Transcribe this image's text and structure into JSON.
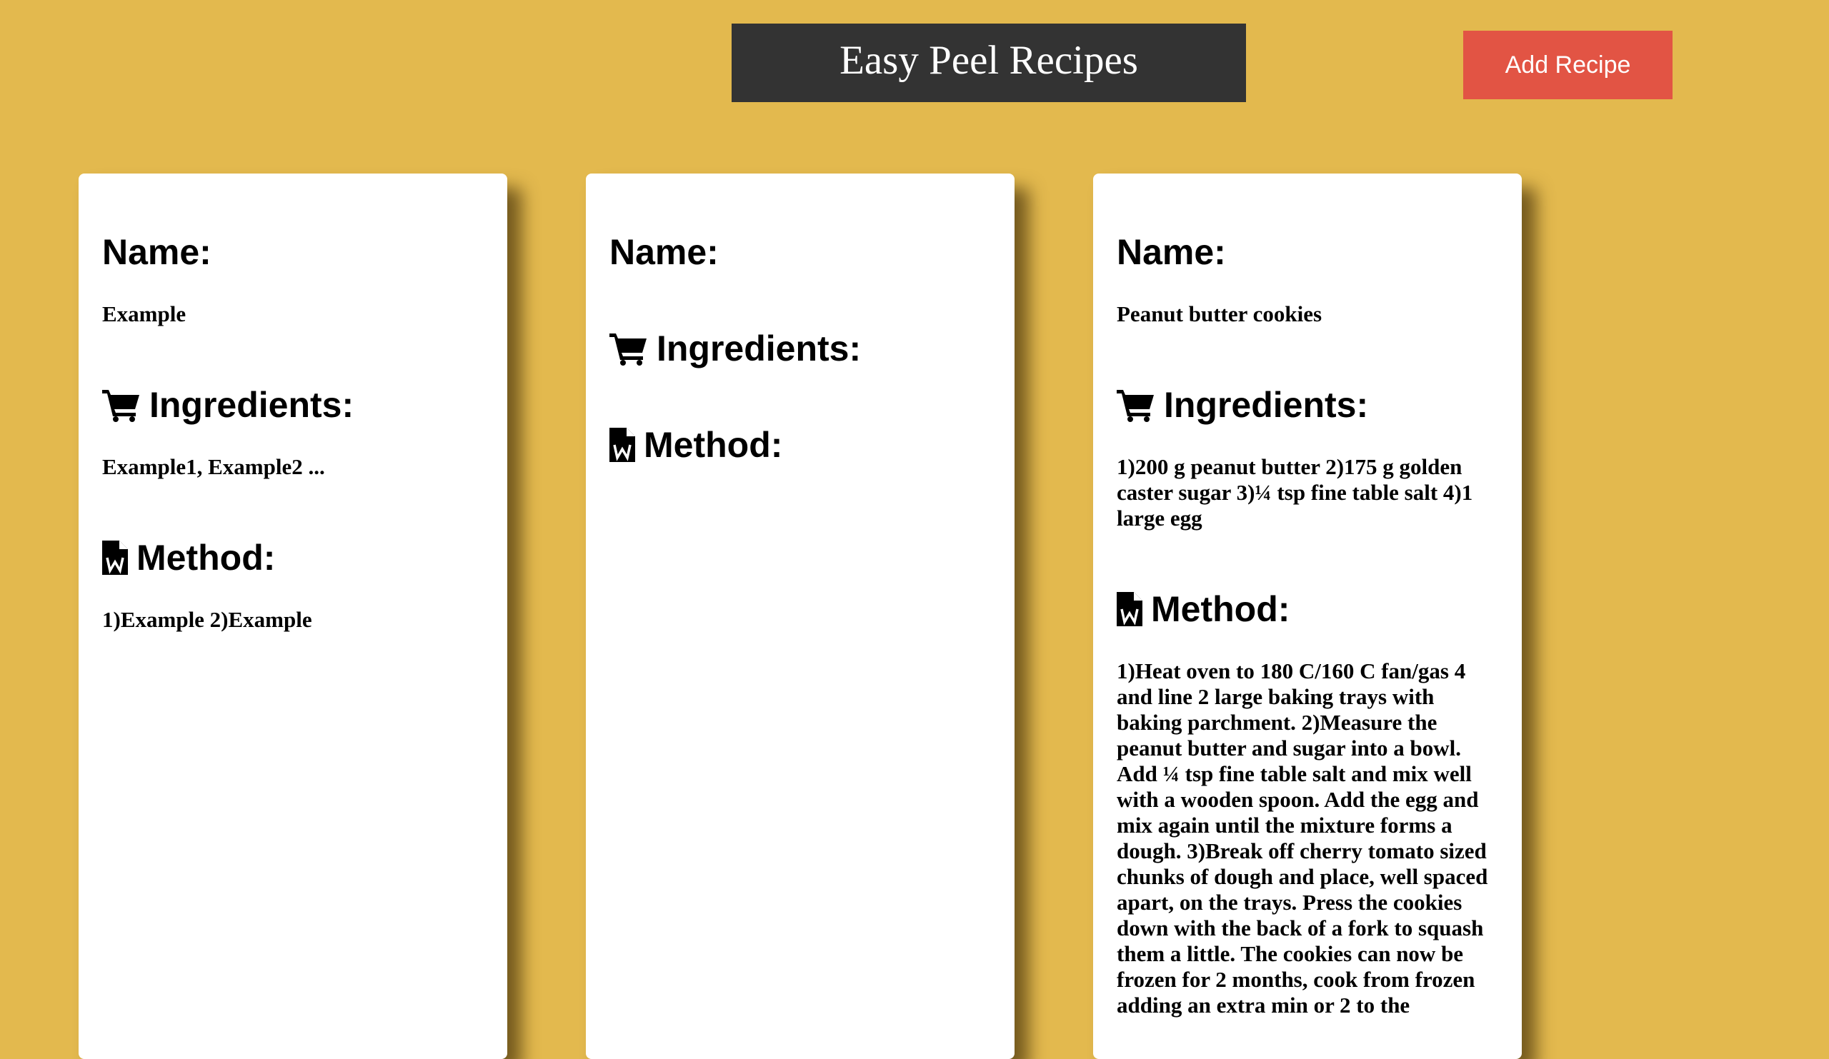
{
  "header": {
    "title": "Easy Peel Recipes",
    "add_button_label": "Add Recipe"
  },
  "labels": {
    "name": "Name:",
    "ingredients": "Ingredients:",
    "method": "Method:"
  },
  "cards": [
    {
      "name": "Example",
      "ingredients": "Example1, Example2 ...",
      "method": "1)Example 2)Example"
    },
    {
      "name": "",
      "ingredients": "",
      "method": ""
    },
    {
      "name": "Peanut butter cookies",
      "ingredients": "1)200 g peanut butter 2)175 g golden caster sugar 3)¼ tsp fine table salt 4)1 large egg",
      "method": "1)Heat oven to 180 C/160 C fan/gas 4 and line 2 large baking trays with baking parchment. 2)Measure the peanut butter and sugar into a bowl. Add ¼ tsp fine table salt and mix well with a wooden spoon. Add the egg and mix again until the mixture forms a dough. 3)Break off cherry tomato sized chunks of dough and place, well spaced apart, on the trays. Press the cookies down with the back of a fork to squash them a little. The cookies can now be frozen for 2 months, cook from frozen adding an extra min or 2 to the"
    }
  ],
  "icons": {
    "ingredients": "shopping-cart-icon",
    "method": "word-document-icon"
  },
  "colors": {
    "background": "#e3b94e",
    "title_bg": "#333333",
    "button_bg": "#e25444",
    "card_bg": "#ffffff"
  }
}
